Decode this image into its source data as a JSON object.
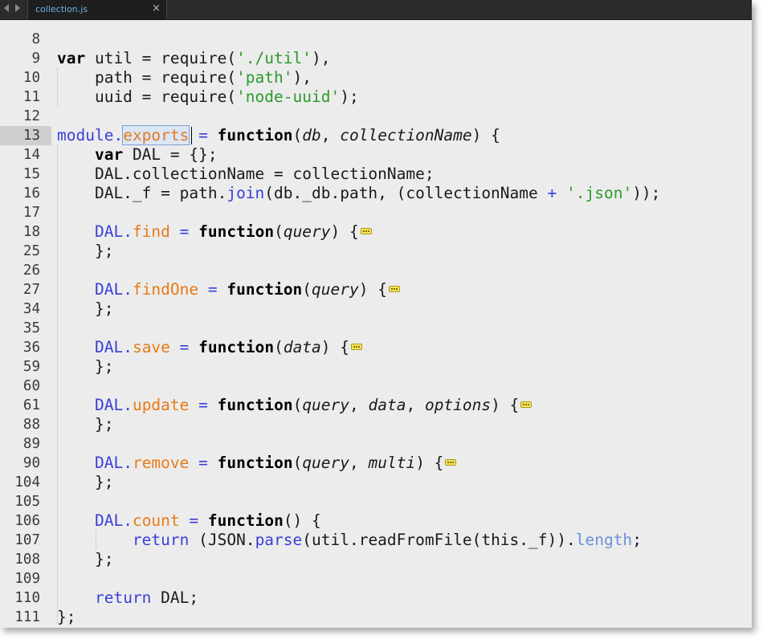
{
  "tab": {
    "filename": "collection.js",
    "close_glyph": "×"
  },
  "lines": [
    {
      "n": "8"
    },
    {
      "n": "9"
    },
    {
      "n": "10"
    },
    {
      "n": "11"
    },
    {
      "n": "12"
    },
    {
      "n": "13"
    },
    {
      "n": "14"
    },
    {
      "n": "15"
    },
    {
      "n": "16"
    },
    {
      "n": "17"
    },
    {
      "n": "18"
    },
    {
      "n": "25"
    },
    {
      "n": "26"
    },
    {
      "n": "27"
    },
    {
      "n": "34"
    },
    {
      "n": "35"
    },
    {
      "n": "36"
    },
    {
      "n": "59"
    },
    {
      "n": "60"
    },
    {
      "n": "61"
    },
    {
      "n": "88"
    },
    {
      "n": "89"
    },
    {
      "n": "90"
    },
    {
      "n": "104"
    },
    {
      "n": "105"
    },
    {
      "n": "106"
    },
    {
      "n": "107"
    },
    {
      "n": "108"
    },
    {
      "n": "109"
    },
    {
      "n": "110"
    },
    {
      "n": "111"
    }
  ],
  "code": {
    "l9": {
      "kw": "var",
      "a": " util = require(",
      "s": "'./util'",
      "b": "),"
    },
    "l10": {
      "a": "    path = require(",
      "s": "'path'",
      "b": "),"
    },
    "l11": {
      "a": "    uuid = require(",
      "s": "'node-uuid'",
      "b": ");"
    },
    "l13": {
      "obj": "module",
      "dot": ".",
      "prop": "exports",
      "eq": " = ",
      "kw": "function",
      "open": "(",
      "p1": "db",
      "comma": ", ",
      "p2": "collectionName",
      "close": ") {"
    },
    "l14": {
      "a": "    ",
      "kw": "var",
      "b": " DAL = {};"
    },
    "l15": {
      "a": "    DAL.collectionName = collectionName;"
    },
    "l16": {
      "a": "    DAL._f = path.",
      "m": "join",
      "b": "(db._db.path, (collectionName ",
      "plus": "+",
      "c": " ",
      "s": "'.json'",
      "d": "));"
    },
    "l18": {
      "obj": "DAL",
      "prop": "find",
      "kw": "function",
      "p": "query"
    },
    "l27": {
      "obj": "DAL",
      "prop": "findOne",
      "kw": "function",
      "p": "query"
    },
    "l36": {
      "obj": "DAL",
      "prop": "save",
      "kw": "function",
      "p": "data"
    },
    "l61": {
      "obj": "DAL",
      "prop": "update",
      "kw": "function",
      "p1": "query",
      "p2": "data",
      "p3": "options"
    },
    "l90": {
      "obj": "DAL",
      "prop": "remove",
      "kw": "function",
      "p1": "query",
      "p2": "multi"
    },
    "l106": {
      "obj": "DAL",
      "prop": "count",
      "kw": "function",
      "rest": "() {"
    },
    "l107": {
      "kw": "return",
      "a": " (JSON.",
      "m": "parse",
      "b": "(util.readFromFile(this._f)).",
      "len": "length",
      "c": ";"
    },
    "closer": "};",
    "l110": {
      "kw": "return",
      "a": " DAL;"
    },
    "l111": "};"
  },
  "colors": {
    "keyword": "#000000",
    "string": "#2a9a2a",
    "object": "#3a3fd6",
    "property": "#e77a16",
    "line_number": "#3a3a3a",
    "background": "#ececec"
  },
  "icons": {
    "fold_marker": "folded-code-icon"
  }
}
